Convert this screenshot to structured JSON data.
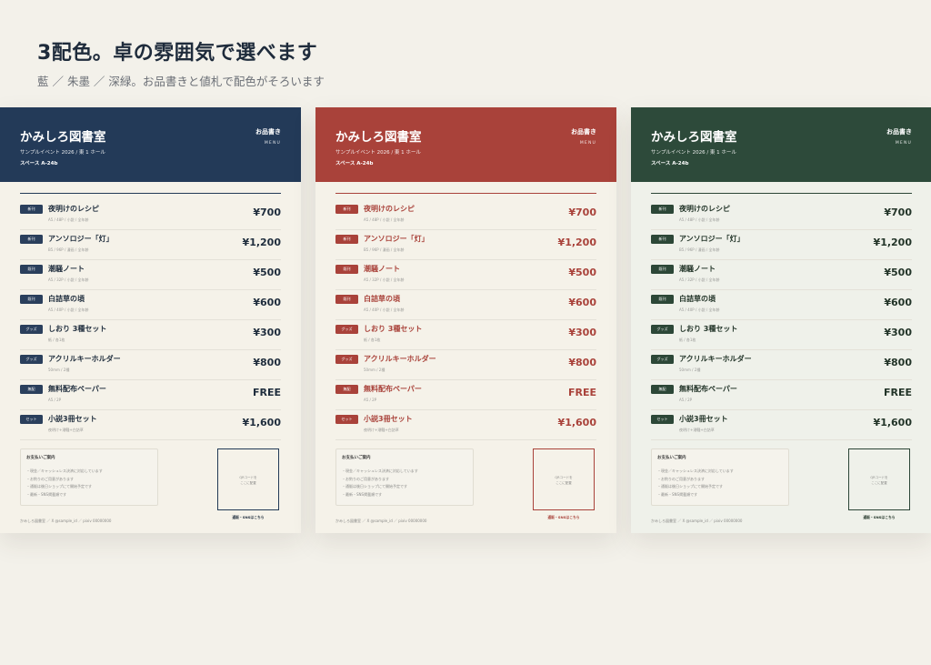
{
  "heading": "3配色。卓の雰囲気で選べます",
  "subheading": "藍 ／ 朱墨 ／ 深緑。お品書きと値札で配色がそろいます",
  "card_content": {
    "shop_name": "かみしろ図書室",
    "event": "サンプルイベント 2026 / 東 1 ホール",
    "space": "スペース A-24b",
    "menu_title": "お品書き",
    "menu_sub": "MENU",
    "items": [
      {
        "badge": "新刊",
        "name": "夜明けのレシピ",
        "spec": "A5 / 48P / 小説 / 全年齢",
        "price": "¥700"
      },
      {
        "badge": "新刊",
        "name": "アンソロジー「灯」",
        "spec": "B5 / 96P / 漫画 / 全年齢",
        "price": "¥1,200"
      },
      {
        "badge": "既刊",
        "name": "潮騒ノート",
        "spec": "A5 / 32P / 小説 / 全年齢",
        "price": "¥500"
      },
      {
        "badge": "既刊",
        "name": "白詰草の頃",
        "spec": "A5 / 40P / 小説 / 全年齢",
        "price": "¥600"
      },
      {
        "badge": "グッズ",
        "name": "しおり 3種セット",
        "spec": "紙 / 各1枚",
        "price": "¥300"
      },
      {
        "badge": "グッズ",
        "name": "アクリルキーホルダー",
        "spec": "50mm / 2種",
        "price": "¥800"
      },
      {
        "badge": "無配",
        "name": "無料配布ペーパー",
        "spec": "A5 / 2P",
        "price": "FREE"
      },
      {
        "badge": "セット",
        "name": "小説3冊セット",
        "spec": "夜明け+潮騒+白詰草",
        "price": "¥1,600"
      }
    ],
    "payment_title": "お支払いご案内",
    "payment_lines": [
      "・現金／キャッシュレス決済に対応しています",
      "・お釣りのご用意があります",
      "・通販は後日ショップにて開始予定です",
      "・最新・SNS掲載順です"
    ],
    "qr_label": "QRコードを\nここに配置",
    "qr_caption": "通販・SNSはこちら",
    "footer": "かみしろ図書室 ／ X @sample_id ／ pixiv 00000000"
  },
  "themes": [
    {
      "name": "藍",
      "header": "#233a58",
      "accent": "#223a56",
      "badge": "#2a3f5c",
      "text": "#1f2d3d",
      "paper": "#f5f2e9"
    },
    {
      "name": "朱墨",
      "header": "#a9423a",
      "accent": "#a9423a",
      "badge": "#a9423a",
      "text": "#a9423a",
      "paper": "#f5f2e9"
    },
    {
      "name": "深緑",
      "header": "#2d4a3a",
      "accent": "#2b4536",
      "badge": "#2c4737",
      "text": "#223428",
      "paper": "#eff1ea"
    }
  ]
}
